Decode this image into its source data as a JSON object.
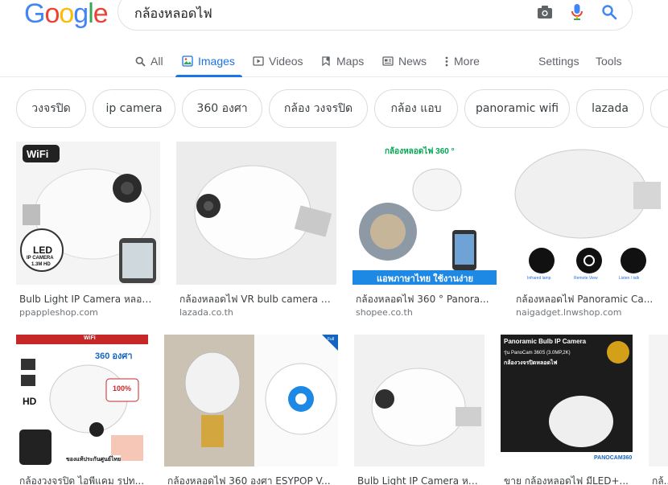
{
  "colors": {
    "accent": "#1a73e8",
    "chip_border": "#dadce0",
    "muted": "#70757a"
  },
  "logo": "Google",
  "search": {
    "query": "กล้องหลอดไฟ",
    "icons": [
      "camera-icon",
      "mic-icon",
      "search-icon"
    ]
  },
  "tabs": [
    {
      "label": "All",
      "icon": "search-icon",
      "active": false
    },
    {
      "label": "Images",
      "icon": "image-icon",
      "active": true
    },
    {
      "label": "Videos",
      "icon": "video-icon",
      "active": false
    },
    {
      "label": "Maps",
      "icon": "map-pin-icon",
      "active": false
    },
    {
      "label": "News",
      "icon": "news-icon",
      "active": false
    },
    {
      "label": "More",
      "icon": "more-vert-icon",
      "active": false
    }
  ],
  "tools": {
    "settings": "Settings",
    "tools": "Tools"
  },
  "chips": [
    "วงจรปิด",
    "ip camera",
    "360 องศา",
    "กล้อง วงจรปิด",
    "กล้อง แอบ",
    "panoramic wifi",
    "lazada"
  ],
  "results_row1": [
    {
      "caption": "Bulb Light IP Camera หลอดไ...",
      "source": "ppappleshop.com",
      "img_text": [
        "WiFi",
        "LED",
        "IP CAMERA",
        "1.3M HD"
      ]
    },
    {
      "caption": "กล้องหลอดไฟ VR bulb camera 3...",
      "source": "lazada.co.th",
      "img_text": []
    },
    {
      "caption": "กล้องหลอดไฟ 360 ° Panora...",
      "source": "shopee.co.th",
      "img_text": [
        "กล้องหลอดไฟ 360 °",
        "แอพภาษาไทย ใช้งานง่าย"
      ]
    },
    {
      "caption": "กล้องหลอดไฟ Panoramic Ca...",
      "source": "naigadget.lnwshop.com",
      "img_text": [
        "Infrared lamp",
        "Remote View",
        "Listen / talk"
      ]
    }
  ],
  "results_row2": [
    {
      "caption": "กล้องวงจรปิด ไอพีแคม รูปท...",
      "source": "",
      "img_text": [
        "WiFi",
        "360 องศา",
        "HD",
        "100%",
        "ของแท้ประกันศูนย์ไทย"
      ]
    },
    {
      "caption": "กล้องหลอดไฟ 360 องศา ESYPOP V...",
      "source": "",
      "img_text": [
        "Full"
      ]
    },
    {
      "caption": "Bulb Light IP Camera หล...",
      "source": "",
      "img_text": []
    },
    {
      "caption": "ขาย กล้องหลอดไฟ มีLED+...",
      "source": "",
      "img_text": [
        "Panoramic Bulb IP Camera",
        "รุ่น PanoCam 360S (3.0MP,2K)",
        "กล้องวงจรปิดหลอดไฟ",
        "PANOCAM360"
      ]
    },
    {
      "caption": "กล้...",
      "source": "",
      "img_text": []
    }
  ]
}
